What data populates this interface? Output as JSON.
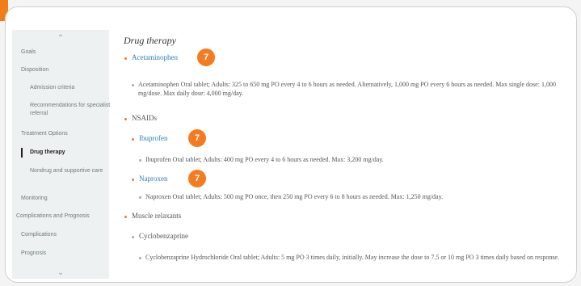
{
  "sidebar": {
    "items": [
      {
        "label": "Goals"
      },
      {
        "label": "Disposition"
      },
      {
        "label": "Admission criteria"
      },
      {
        "label": "Recommendations for specialist referral"
      },
      {
        "label": "Treatment Options"
      },
      {
        "label": "Drug therapy"
      },
      {
        "label": "Nondrug and supportive care"
      },
      {
        "label": "Monitoring"
      },
      {
        "label": "Complications and Prognosis"
      },
      {
        "label": "Complications"
      },
      {
        "label": "Prognosis"
      }
    ],
    "active_label": "Drug therapy"
  },
  "content": {
    "title": "Drug therapy",
    "acetaminophen": {
      "label": "Acetaminophen",
      "badge": "7",
      "detail": "Acetaminophen Oral tablet; Adults: 325 to 650 mg PO every 4 to 6 hours as needed. Alternatively, 1,000 mg PO every 6 hours as needed. Max single dose: 1,000 mg/dose. Max daily dose: 4,000 mg/day."
    },
    "nsaids": {
      "label": "NSAIDs",
      "ibuprofen": {
        "label": "Ibuprofen",
        "badge": "7",
        "detail": "Ibuprofen Oral tablet; Adults: 400 mg PO every 4 to 6 hours as needed. Max: 3,200 mg/day."
      },
      "naproxen": {
        "label": "Naproxen",
        "badge": "7",
        "detail": "Naproxen Oral tablet; Adults: 500 mg PO once, then 250 mg PO every 6 to 8 hours as needed. Max: 1,250 mg/day."
      }
    },
    "muscle_relaxants": {
      "label": "Muscle relaxants",
      "cyclobenzaprine": {
        "label": "Cyclobenzaprine",
        "detail": "Cyclobenzaprine Hydrochloride Oral tablet; Adults: 5 mg PO 3 times daily, initially. May increase the dose to 7.5 or 10 mg PO 3 times daily based on response."
      }
    }
  },
  "colors": {
    "accent_orange": "#f47b20",
    "link_blue": "#2f7fb3",
    "sidebar_bg": "#eef1f1"
  },
  "icons": {
    "scroll_up": "chevron-up-icon",
    "scroll_down": "chevron-down-icon"
  }
}
